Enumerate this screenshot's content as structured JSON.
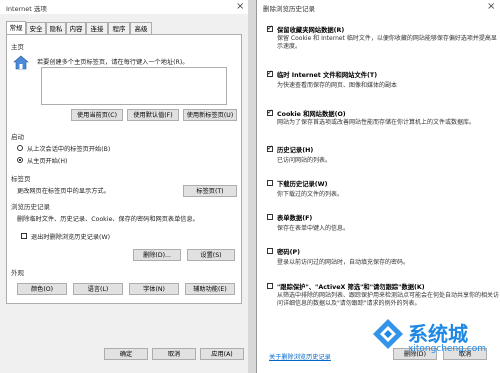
{
  "left_window": {
    "title": "Internet 选项",
    "tabs": [
      "常规",
      "安全",
      "隐私",
      "内容",
      "连接",
      "程序",
      "高级"
    ],
    "homepage": {
      "section_label": "主页",
      "instruction": "若要创建多个主页标签页，请在每行键入一个地址(R)。",
      "buttons": [
        "使用当前页(C)",
        "使用默认值(F)",
        "使用新标签页(U)"
      ]
    },
    "startup": {
      "section_label": "启动",
      "options": [
        "从上次会话中的标签页开始(B)",
        "从主页开始(H)"
      ],
      "selected_index": 1
    },
    "tabs_section": {
      "section_label": "标签页",
      "description": "更改网页在标签页中的显示方式。",
      "button": "标签页(T)"
    },
    "history": {
      "section_label": "浏览历史记录",
      "description": "删除临时文件、历史记录、Cookie、保存的密码和网页表单信息。",
      "checkbox_label": "退出时删除浏览历史记录(W)",
      "checked": false,
      "buttons": [
        "删除(D)...",
        "设置(S)"
      ]
    },
    "appearance": {
      "section_label": "外观",
      "buttons": [
        "颜色(O)",
        "语言(L)",
        "字体(N)",
        "辅助功能(E)"
      ]
    },
    "footer_buttons": [
      "确定",
      "取消",
      "应用(A)"
    ]
  },
  "right_window": {
    "title": "删除浏览历史记录",
    "options": [
      {
        "title": "保留收藏夹网站数据(R)",
        "desc": "保留 Cookie 和 Internet 临时文件，以便你收藏的网站能够保存偏好选项并提高显示速度。",
        "checked": true
      },
      {
        "title": "临时 Internet 文件和网站文件(T)",
        "desc": "为快速查看而保存的网页、图像和媒体的副本",
        "checked": true
      },
      {
        "title": "Cookie 和网站数据(O)",
        "desc": "网站为了保存首选项或改善网站性能而存储在你计算机上的文件或数据库。",
        "checked": true
      },
      {
        "title": "历史记录(H)",
        "desc": "已访问网站的列表。",
        "checked": true
      },
      {
        "title": "下载历史记录(W)",
        "desc": "你下载过的文件的列表。",
        "checked": false
      },
      {
        "title": "表单数据(F)",
        "desc": "保存在表单中键入的信息。",
        "checked": false
      },
      {
        "title": "密码(P)",
        "desc": "登录以前访问过的网站时，自动填充保存的密码。",
        "checked": false
      },
      {
        "title": "\"跟踪保护\"、\"ActiveX 筛选\"和\"请勿跟踪\"数据(K)",
        "desc": "从筛选中排除的网站列表、跟踪保护用来检测站点可能会在何处自动共享你的相关访问详细信息的数据以及\"请勿跟踪\"请求的例外的列表。",
        "checked": false
      }
    ],
    "link": "关于删除浏览历史记录",
    "buttons": [
      "删除(D)",
      "取消"
    ]
  },
  "watermark": {
    "text": "系统城",
    "url": "xitongcheng.com"
  },
  "colors": {
    "link": "#0066cc",
    "watermark": "#1e88e5"
  }
}
